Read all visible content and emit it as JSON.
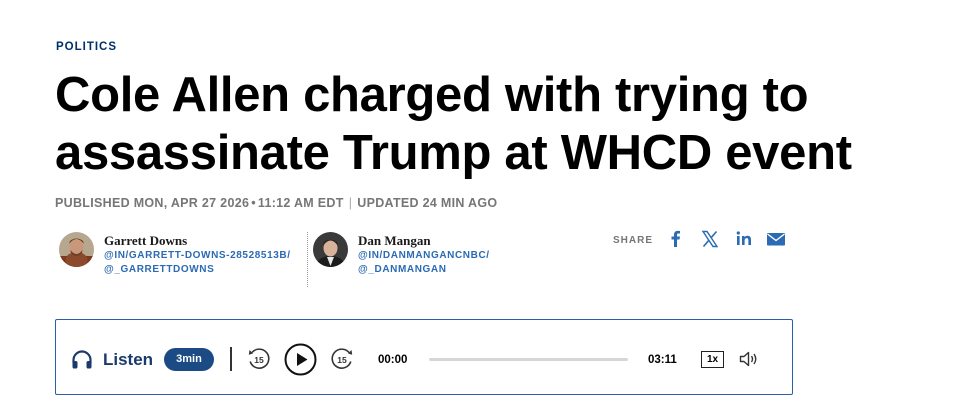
{
  "article": {
    "section": "POLITICS",
    "headline": "Cole Allen charged with trying to assassinate Trump at WHCD event",
    "published": "PUBLISHED MON, APR 27 2026",
    "published_time": "11:12 AM EDT",
    "updated": "UPDATED 24 MIN AGO"
  },
  "authors": [
    {
      "name": "Garrett Downs",
      "link1": "@IN/GARRETT-DOWNS-28528513B/",
      "link2": "@_GARRETTDOWNS"
    },
    {
      "name": "Dan Mangan",
      "link1": "@IN/DANMANGANCNBC/",
      "link2": "@_DANMANGAN"
    }
  ],
  "share": {
    "label": "SHARE",
    "icons": [
      "facebook-icon",
      "x-icon",
      "linkedin-icon",
      "email-icon"
    ],
    "color": "#2a6bb3"
  },
  "player": {
    "listen_label": "Listen",
    "duration_badge": "3min",
    "rewind_seconds": "15",
    "forward_seconds": "15",
    "current_time": "00:00",
    "total_time": "03:11",
    "speed": "1x",
    "progress": 0,
    "border_color": "#2a5ea8"
  }
}
